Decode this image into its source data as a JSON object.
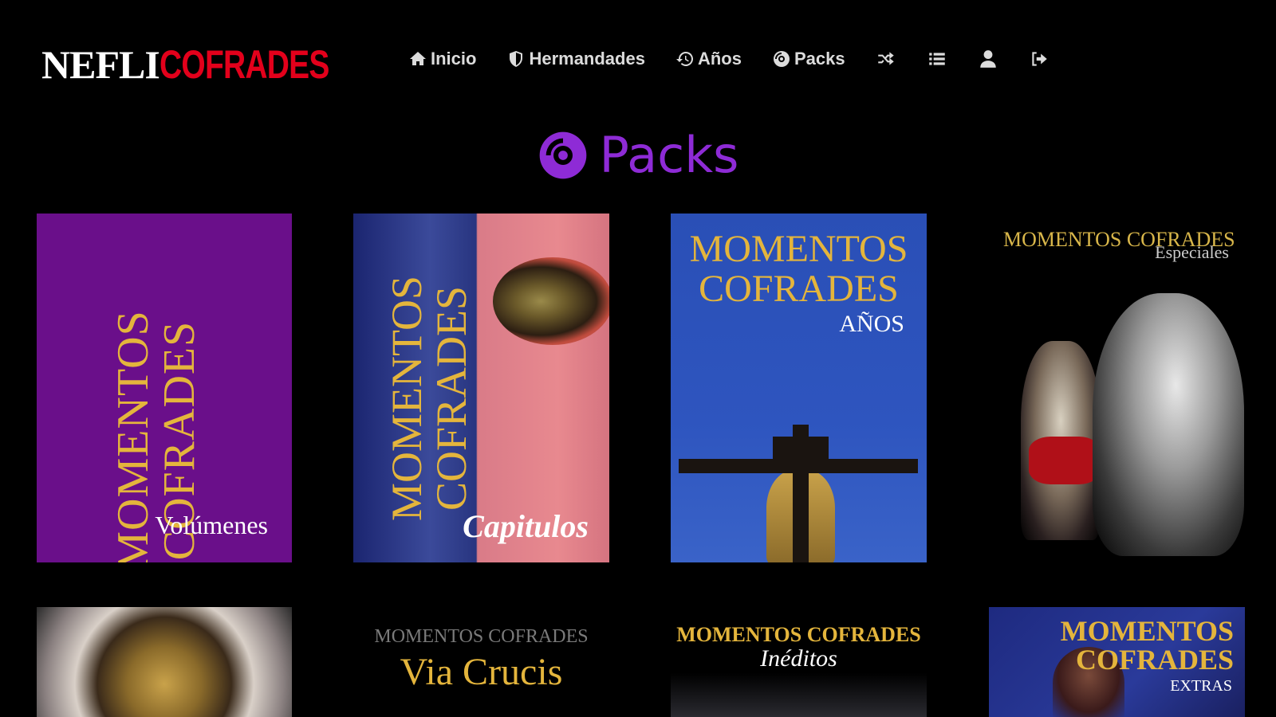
{
  "brand": {
    "part1": "NEFLI",
    "part2": "COFRADES"
  },
  "nav": {
    "items": [
      {
        "label": "Inicio",
        "icon": "home-icon"
      },
      {
        "label": "Hermandades",
        "icon": "shield-icon"
      },
      {
        "label": "Años",
        "icon": "history-icon"
      },
      {
        "label": "Packs",
        "icon": "disc-icon"
      }
    ],
    "icons": [
      "shuffle-icon",
      "list-icon",
      "user-icon",
      "logout-icon"
    ]
  },
  "page": {
    "title": "Packs",
    "title_icon": "disc-icon",
    "accent": "#8e2bd6"
  },
  "packs": [
    {
      "title": "MOMENTOS COFRADES",
      "subtitle": "Volúmenes"
    },
    {
      "title": "MOMENTOS COFRADES",
      "subtitle": "Capitulos"
    },
    {
      "title": "MOMENTOS COFRADES",
      "subtitle": "AÑOS"
    },
    {
      "title": "MOMENTOS COFRADES",
      "subtitle": "Especiales"
    },
    {
      "title": "",
      "subtitle": ""
    },
    {
      "title": "MOMENTOS COFRADES",
      "subtitle": "Via Crucis"
    },
    {
      "title": "MOMENTOS COFRADES",
      "subtitle": "Inéditos"
    },
    {
      "title": "MOMENTOS COFRADES",
      "subtitle": "EXTRAS"
    }
  ],
  "colors": {
    "background": "#000000",
    "brand_red": "#e3001b",
    "gold": "#e4b53c"
  }
}
